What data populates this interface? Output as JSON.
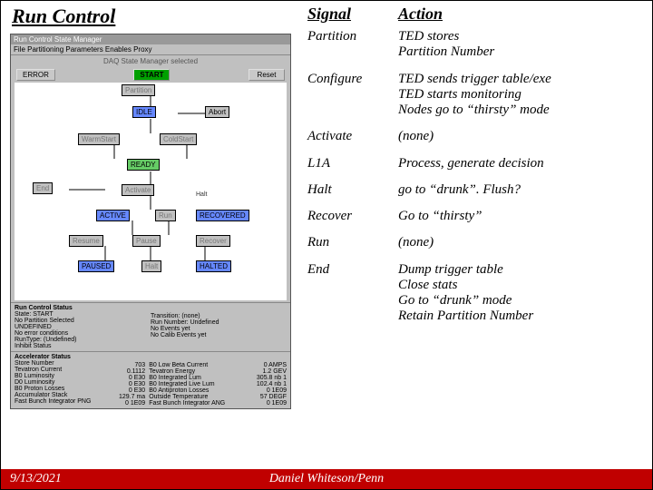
{
  "title": "Run Control",
  "gui": {
    "titlebar": "Run Control State Manager",
    "menu": "File  Partitioning  Parameters  Enables  Proxy",
    "statusline": "DAQ State Manager selected",
    "buttons": {
      "error": "ERROR",
      "start": "START",
      "reset": "Reset"
    },
    "nodes": {
      "partition": "Partition",
      "idle": "IDLE",
      "abort": "Abort",
      "warmstart": "WarmStart",
      "coldstart": "ColdStart",
      "end": "End",
      "ready": "READY",
      "activate": "Activate",
      "active": "ACTIVE",
      "run": "Run",
      "recovered": "RECOVERED",
      "resume": "Resume",
      "pause": "Pause",
      "recover": "Recover",
      "paused": "PAUSED",
      "halt": "Halt",
      "halted": "HALTED"
    },
    "status": {
      "header": "Run Control Status",
      "left": "State: START\nNo Partition Selected\nUNDEFINED\nNo error conditions\nRunType: (Undefined)\nInhibit Status",
      "right": "Transition: (none)\nRun Number: Undefined\nNo Events yet\nNo Calib Events yet"
    },
    "accel": {
      "header": "Accelerator Status",
      "left": "Store Number\nTevatron Current\nB0 Luminosity\nD0 Luminosity\nB0 Proton Losses\nAccumulator Stack\nFast Bunch Integrator PNG",
      "mid": "703\n0.1112\n0 E30\n0 E30\n0 E30\n129.7 ma\n0 1E09",
      "right1": "B0 Low Beta Current\nTevatron Energy\nB0 Integrated Lum\nB0 Integrated Live Lum\nB0 Antiproton Losses\nOutside Temperature\nFast Bunch Integrator ANG",
      "right2": "0 AMPS\n1.2 GEV\n305.8 nb 1\n102.4 nb 1\n0 1E09\n57 DEGF\n0 1E09"
    }
  },
  "table": {
    "headers": {
      "signal": "Signal",
      "action": "Action"
    },
    "rows": [
      {
        "signal": "Partition",
        "action": "TED  stores\n  Partition Number"
      },
      {
        "signal": "Configure",
        "action": "TED sends trigger table/exe\nTED starts monitoring\nNodes go to “thirsty” mode"
      },
      {
        "signal": "Activate",
        "action": "(none)"
      },
      {
        "signal": "L1A",
        "action": "Process, generate decision"
      },
      {
        "signal": "Halt",
        "action": "go to “drunk”. Flush?"
      },
      {
        "signal": "Recover",
        "action": "Go to “thirsty”"
      },
      {
        "signal": "Run",
        "action": "(none)"
      },
      {
        "signal": "End",
        "action": "Dump trigger table\nClose stats\nGo to “drunk” mode\nRetain Partition Number"
      }
    ]
  },
  "footer": {
    "date": "9/13/2021",
    "author": "Daniel Whiteson/Penn"
  }
}
